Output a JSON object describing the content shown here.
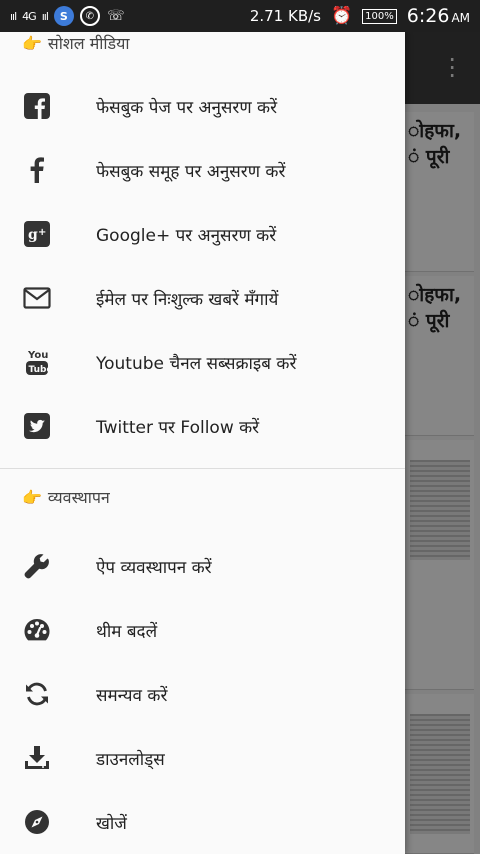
{
  "status_bar": {
    "signal1": "ııl",
    "network": "4G",
    "signal2": "ııl",
    "speed": "2.71 KB/s",
    "battery": "100%",
    "time": "6:26",
    "ampm": "AM"
  },
  "background": {
    "card1_line1": "ोहफा,",
    "card1_line2": "ं पूरी",
    "card2_line1": "ोहफा,",
    "card2_line2": "ं पूरी"
  },
  "drawer": {
    "social_header": "सोशल मीडिया",
    "social_items": [
      {
        "label": "फेसबुक पेज पर अनुसरण करें",
        "icon": "facebook-square-icon"
      },
      {
        "label": "फेसबुक समूह पर अनुसरण करें",
        "icon": "facebook-f-icon"
      },
      {
        "label": "Google+ पर अनुसरण करें",
        "icon": "google-plus-icon"
      },
      {
        "label": "ईमेल पर निःशुल्क खबरें मँगायें",
        "icon": "email-icon"
      },
      {
        "label": "Youtube चैनल सब्सक्राइब करें",
        "icon": "youtube-icon"
      },
      {
        "label": "Twitter पर Follow करें",
        "icon": "twitter-icon"
      }
    ],
    "manage_header": "व्यवस्थापन",
    "manage_items": [
      {
        "label": "ऐप व्यवस्थापन करें",
        "icon": "wrench-icon"
      },
      {
        "label": "थीम बदलें",
        "icon": "palette-icon"
      },
      {
        "label": "समन्यव करें",
        "icon": "sync-icon"
      },
      {
        "label": "डाउनलोड्स",
        "icon": "download-icon"
      },
      {
        "label": "खोजें",
        "icon": "compass-icon"
      }
    ]
  }
}
